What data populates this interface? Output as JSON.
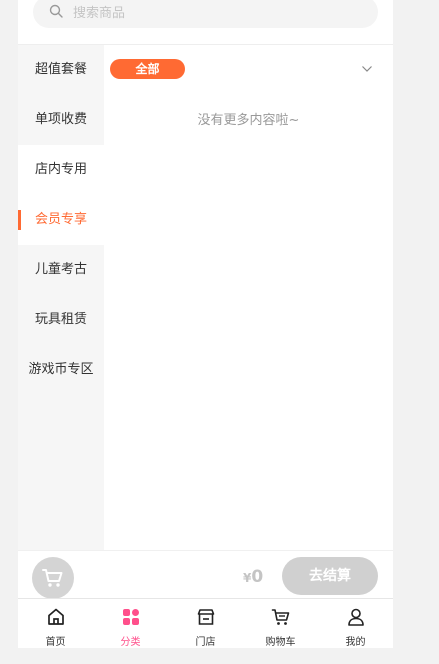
{
  "search": {
    "placeholder": "搜索商品",
    "value": ""
  },
  "sidebar": {
    "items": [
      {
        "label": "超值套餐"
      },
      {
        "label": "单项收费"
      },
      {
        "label": "店内专用"
      },
      {
        "label": "会员专享"
      },
      {
        "label": "儿童考古"
      },
      {
        "label": "玩具租赁"
      },
      {
        "label": "游戏币专区"
      }
    ],
    "active_index": 3
  },
  "content": {
    "filter_label": "全部",
    "empty_text": "没有更多内容啦~"
  },
  "checkout": {
    "currency": "¥",
    "amount": "0",
    "button_label": "去结算"
  },
  "tabbar": {
    "items": [
      {
        "label": "首页",
        "icon": "home-icon"
      },
      {
        "label": "分类",
        "icon": "category-icon"
      },
      {
        "label": "门店",
        "icon": "store-icon"
      },
      {
        "label": "购物车",
        "icon": "cart-icon"
      },
      {
        "label": "我的",
        "icon": "user-icon"
      }
    ],
    "active_index": 1
  },
  "colors": {
    "accent": "#ff6a33",
    "tab_active": "#ff4f8b",
    "disabled": "#d0d0d0"
  }
}
